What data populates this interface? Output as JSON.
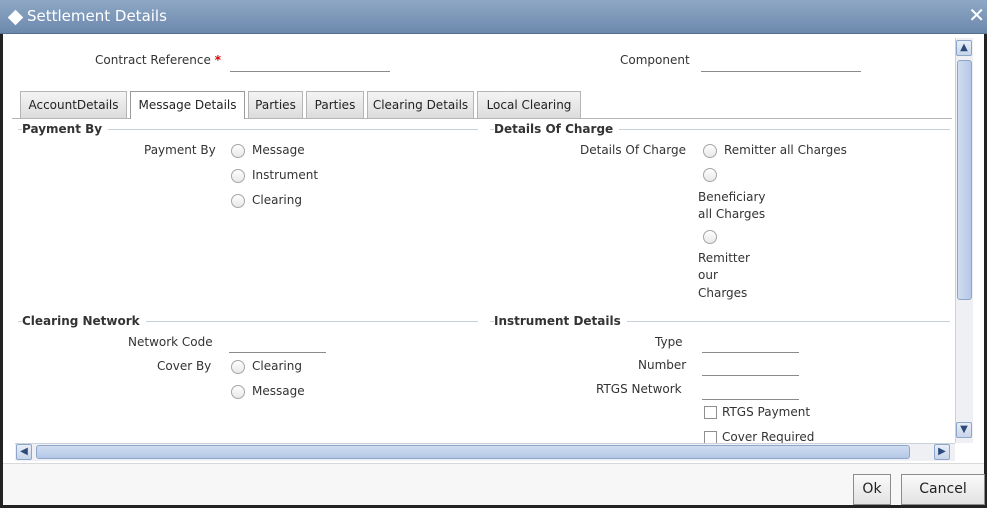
{
  "window": {
    "title": "Settlement Details",
    "close_glyph": "✕"
  },
  "header": {
    "contract_reference_label": "Contract Reference",
    "required_mark": "*",
    "contract_reference_value": "",
    "component_label": "Component",
    "component_value": ""
  },
  "tabs": [
    {
      "label": "AccountDetails",
      "active": false
    },
    {
      "label": "Message Details",
      "active": true
    },
    {
      "label": "Parties",
      "active": false
    },
    {
      "label": "Parties",
      "active": false
    },
    {
      "label": "Clearing Details",
      "active": false
    },
    {
      "label": "Local Clearing",
      "active": false
    }
  ],
  "payment_by": {
    "section_title": "Payment By",
    "field_label": "Payment By",
    "options": [
      "Message",
      "Instrument",
      "Clearing"
    ]
  },
  "details_of_charge": {
    "section_title": "Details Of Charge",
    "field_label": "Details Of Charge",
    "options": [
      "Remitter all Charges",
      "Beneficiary all Charges",
      "Remitter our Charges"
    ],
    "option_lines": [
      [
        "Remitter all Charges"
      ],
      [
        "Beneficiary",
        "all Charges"
      ],
      [
        "Remitter",
        "our",
        "Charges"
      ]
    ]
  },
  "clearing_network": {
    "section_title": "Clearing Network",
    "network_code_label": "Network Code",
    "network_code_value": "",
    "cover_by_label": "Cover By",
    "cover_by_options": [
      "Clearing",
      "Message"
    ]
  },
  "instrument_details": {
    "section_title": "Instrument Details",
    "type_label": "Type",
    "type_value": "",
    "number_label": "Number",
    "number_value": "",
    "rtgs_network_label": "RTGS Network",
    "rtgs_network_value": "",
    "rtgs_payment_label": "RTGS Payment",
    "cover_required_label": "Cover Required"
  },
  "footer": {
    "ok_label": "Ok",
    "cancel_label": "Cancel"
  },
  "icons": {
    "window": "diamond-icon",
    "close": "close-icon",
    "scroll_up": "arrow-up-icon",
    "scroll_down": "arrow-down-icon",
    "scroll_left": "arrow-left-icon",
    "scroll_right": "arrow-right-icon"
  },
  "colors": {
    "titlebar": "#7b95b8",
    "required": "#d40000",
    "scroll_accent": "#b4c8e6"
  }
}
